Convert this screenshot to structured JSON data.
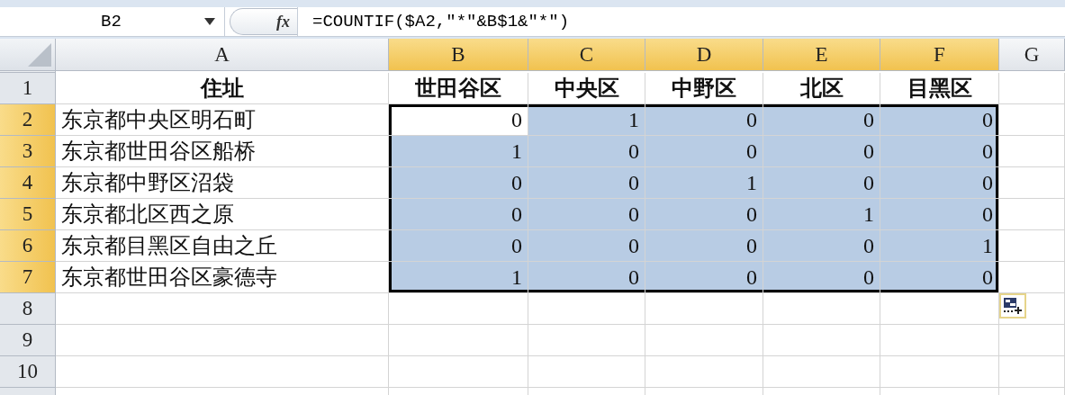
{
  "formula_bar": {
    "name_box": "B2",
    "fx": "fx",
    "formula": "=COUNTIF($A2,″*″&B$1&″*″)"
  },
  "columns": [
    {
      "label": "A",
      "selected": false
    },
    {
      "label": "B",
      "selected": true
    },
    {
      "label": "C",
      "selected": true
    },
    {
      "label": "D",
      "selected": true
    },
    {
      "label": "E",
      "selected": true
    },
    {
      "label": "F",
      "selected": true
    },
    {
      "label": "G",
      "selected": false
    }
  ],
  "rows": [
    {
      "header": "1",
      "selected": false,
      "cells": [
        {
          "value": "住址",
          "kind": "heading",
          "selected": false
        },
        {
          "value": "世田谷区",
          "kind": "heading",
          "selected": false
        },
        {
          "value": "中央区",
          "kind": "heading",
          "selected": false
        },
        {
          "value": "中野区",
          "kind": "heading",
          "selected": false
        },
        {
          "value": "北区",
          "kind": "heading",
          "selected": false
        },
        {
          "value": "目黑区",
          "kind": "heading",
          "selected": false
        }
      ]
    },
    {
      "header": "2",
      "selected": true,
      "cells": [
        {
          "value": "东京都中央区明石町",
          "kind": "text",
          "selected": false
        },
        {
          "value": "0",
          "kind": "number",
          "selected": true,
          "active": true
        },
        {
          "value": "1",
          "kind": "number",
          "selected": true
        },
        {
          "value": "0",
          "kind": "number",
          "selected": true
        },
        {
          "value": "0",
          "kind": "number",
          "selected": true
        },
        {
          "value": "0",
          "kind": "number",
          "selected": true
        }
      ]
    },
    {
      "header": "3",
      "selected": true,
      "cells": [
        {
          "value": "东京都世田谷区船桥",
          "kind": "text",
          "selected": false
        },
        {
          "value": "1",
          "kind": "number",
          "selected": true
        },
        {
          "value": "0",
          "kind": "number",
          "selected": true
        },
        {
          "value": "0",
          "kind": "number",
          "selected": true
        },
        {
          "value": "0",
          "kind": "number",
          "selected": true
        },
        {
          "value": "0",
          "kind": "number",
          "selected": true
        }
      ]
    },
    {
      "header": "4",
      "selected": true,
      "cells": [
        {
          "value": "东京都中野区沼袋",
          "kind": "text",
          "selected": false
        },
        {
          "value": "0",
          "kind": "number",
          "selected": true
        },
        {
          "value": "0",
          "kind": "number",
          "selected": true
        },
        {
          "value": "1",
          "kind": "number",
          "selected": true
        },
        {
          "value": "0",
          "kind": "number",
          "selected": true
        },
        {
          "value": "0",
          "kind": "number",
          "selected": true
        }
      ]
    },
    {
      "header": "5",
      "selected": true,
      "cells": [
        {
          "value": "东京都北区西之原",
          "kind": "text",
          "selected": false
        },
        {
          "value": "0",
          "kind": "number",
          "selected": true
        },
        {
          "value": "0",
          "kind": "number",
          "selected": true
        },
        {
          "value": "0",
          "kind": "number",
          "selected": true
        },
        {
          "value": "1",
          "kind": "number",
          "selected": true
        },
        {
          "value": "0",
          "kind": "number",
          "selected": true
        }
      ]
    },
    {
      "header": "6",
      "selected": true,
      "cells": [
        {
          "value": "东京都目黑区自由之丘",
          "kind": "text",
          "selected": false
        },
        {
          "value": "0",
          "kind": "number",
          "selected": true
        },
        {
          "value": "0",
          "kind": "number",
          "selected": true
        },
        {
          "value": "0",
          "kind": "number",
          "selected": true
        },
        {
          "value": "0",
          "kind": "number",
          "selected": true
        },
        {
          "value": "1",
          "kind": "number",
          "selected": true
        }
      ]
    },
    {
      "header": "7",
      "selected": true,
      "cells": [
        {
          "value": "东京都世田谷区豪德寺",
          "kind": "text",
          "selected": false
        },
        {
          "value": "1",
          "kind": "number",
          "selected": true
        },
        {
          "value": "0",
          "kind": "number",
          "selected": true
        },
        {
          "value": "0",
          "kind": "number",
          "selected": true
        },
        {
          "value": "0",
          "kind": "number",
          "selected": true
        },
        {
          "value": "0",
          "kind": "number",
          "selected": true
        }
      ]
    },
    {
      "header": "8",
      "selected": false
    },
    {
      "header": "9",
      "selected": false
    },
    {
      "header": "10",
      "selected": false
    }
  ]
}
